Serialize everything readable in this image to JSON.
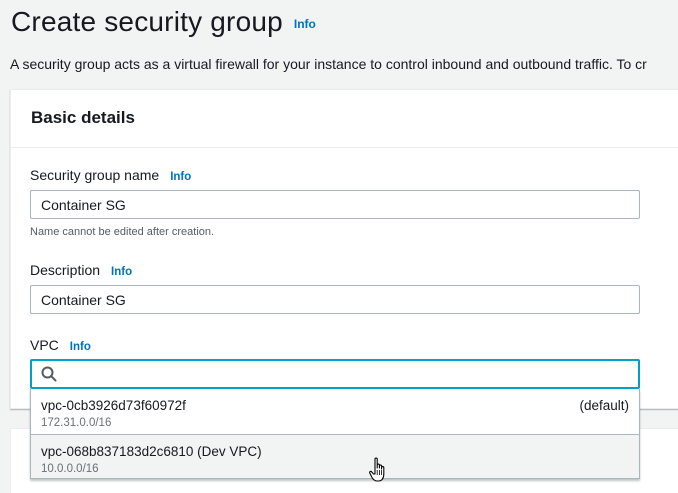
{
  "header": {
    "title": "Create security group",
    "info": "Info",
    "intro": "A security group acts as a virtual firewall for your instance to control inbound and outbound traffic. To cr"
  },
  "basic_details": {
    "title": "Basic details",
    "name_field": {
      "label": "Security group name",
      "info": "Info",
      "value": "Container SG",
      "hint": "Name cannot be edited after creation."
    },
    "description_field": {
      "label": "Description",
      "info": "Info",
      "value": "Container SG"
    },
    "vpc_field": {
      "label": "VPC",
      "info": "Info",
      "search_value": "",
      "options": [
        {
          "id": "vpc-0cb3926d73f60972f",
          "tag": "(default)",
          "cidr": "172.31.0.0/16"
        },
        {
          "id": "vpc-068b837183d2c6810 (Dev VPC)",
          "tag": "",
          "cidr": "10.0.0.0/16"
        }
      ]
    }
  },
  "icons": {
    "search": "search-icon",
    "cursor": "hand-pointer-icon"
  },
  "colors": {
    "accent": "#00a1c9",
    "link": "#0073bb",
    "hover_option": "#f2f3f3"
  }
}
